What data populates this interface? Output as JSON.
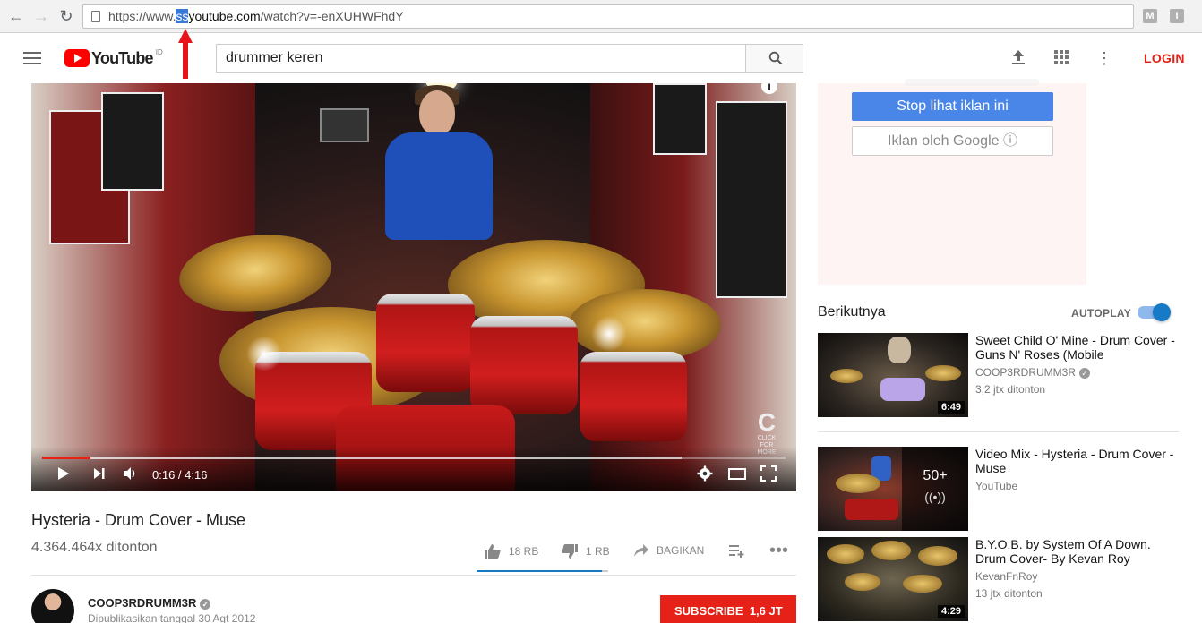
{
  "browser": {
    "url_prefix": "https://www.",
    "url_selected": "ss",
    "url_host": "youtube.com",
    "url_path": "/watch?v=-enXUHWFhdY",
    "ext1": "M",
    "ext2": "I"
  },
  "header": {
    "logo_text": "YouTube",
    "logo_country": "ID",
    "search_value": "drummer keren",
    "login_label": "LOGIN"
  },
  "player": {
    "time": "0:16 / 4:16",
    "progress_played": 0.065,
    "progress_loaded": 0.86,
    "overlay_text": "CLICK FOR MORE",
    "overlay_logo": "C"
  },
  "video": {
    "title": "Hysteria - Drum Cover - Muse",
    "views": "4.364.464x ditonton",
    "likes": "18 RB",
    "dislikes": "1 RB",
    "share_label": "BAGIKAN",
    "like_ratio": 0.95
  },
  "owner": {
    "channel": "COOP3RDRUMM3R",
    "published": "Dipublikasikan tanggal 30 Agt 2012",
    "subscribe_label": "SUBSCRIBE",
    "subscribers": "1,6 JT"
  },
  "ad": {
    "stop_label": "Stop lihat iklan ini",
    "google_label": "Iklan oleh Google ⓘ"
  },
  "sidebar": {
    "up_next_label": "Berikutnya",
    "autoplay_label": "AUTOPLAY",
    "autoplay_on": true,
    "items": [
      {
        "title": "Sweet Child O' Mine - Drum Cover - Guns N' Roses (Mobile",
        "channel": "COOP3RDRUMM3R",
        "views": "3,2 jtx ditonton",
        "duration": "6:49"
      },
      {
        "title": "Video Mix - Hysteria - Drum Cover - Muse",
        "channel": "YouTube",
        "views": "",
        "playlist_count": "50+"
      },
      {
        "title": "B.Y.O.B. by System Of A Down. Drum Cover- By Kevan Roy",
        "channel": "KevanFnRoy",
        "views": "13 jtx ditonton",
        "duration": "4:29"
      }
    ]
  }
}
